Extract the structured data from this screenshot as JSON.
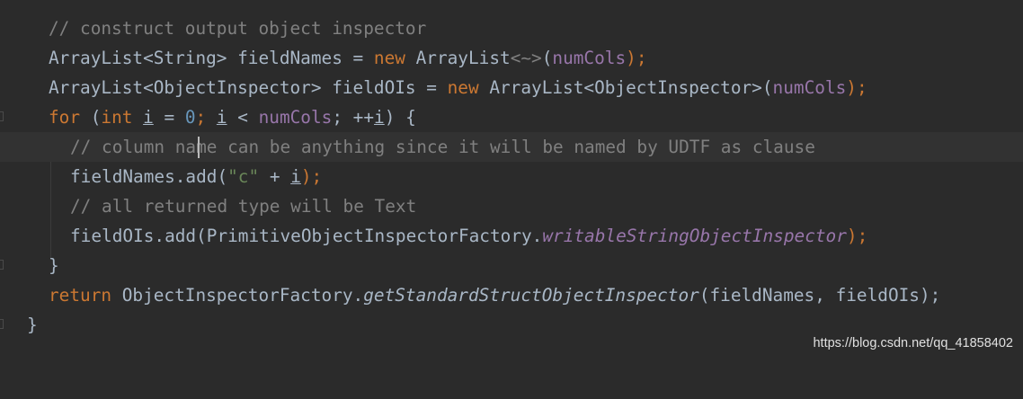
{
  "editor": {
    "theme_colors": {
      "background": "#2b2b2b",
      "keyword": "#cc7832",
      "number": "#6897bb",
      "field": "#9876aa",
      "string": "#6a8759",
      "comment": "#808080",
      "text": "#a9b7c6"
    },
    "lines": [
      {
        "tokens": [
          "// construct output object inspector"
        ]
      },
      {
        "tokens": [
          "ArrayList<String> fieldNames = ",
          "new",
          " ArrayList",
          "<~>",
          "(",
          "numCols",
          ");"
        ]
      },
      {
        "tokens": [
          "ArrayList<ObjectInspector> fieldOIs = ",
          "new",
          " ArrayList<ObjectInspector>(",
          "numCols",
          ");"
        ]
      },
      {
        "tokens": [
          "for",
          " (",
          "int",
          " ",
          "i",
          " = ",
          "0",
          "; ",
          "i",
          " < ",
          "numCols",
          "; ++",
          "i",
          ") {"
        ]
      },
      {
        "tokens": [
          "// column name can be anything since it will be named by UDTF as clause"
        ]
      },
      {
        "tokens": [
          "fieldNames.add(",
          "\"c\"",
          " + ",
          "i",
          ");"
        ]
      },
      {
        "tokens": [
          "// all returned type will be Text"
        ]
      },
      {
        "tokens": [
          "fieldOIs.add(PrimitiveObjectInspectorFactory.",
          "writableStringObjectInspector",
          ");"
        ]
      },
      {
        "tokens": [
          "}"
        ]
      },
      {
        "tokens": [
          "return",
          " ObjectInspectorFactory.",
          "getStandardStructObjectInspector",
          "(fieldNames, fieldOIs);"
        ]
      },
      {
        "tokens": [
          "}"
        ]
      }
    ],
    "icons": {
      "intention": "lightbulb-icon"
    }
  },
  "watermark": "https://blog.csdn.net/qq_41858402"
}
